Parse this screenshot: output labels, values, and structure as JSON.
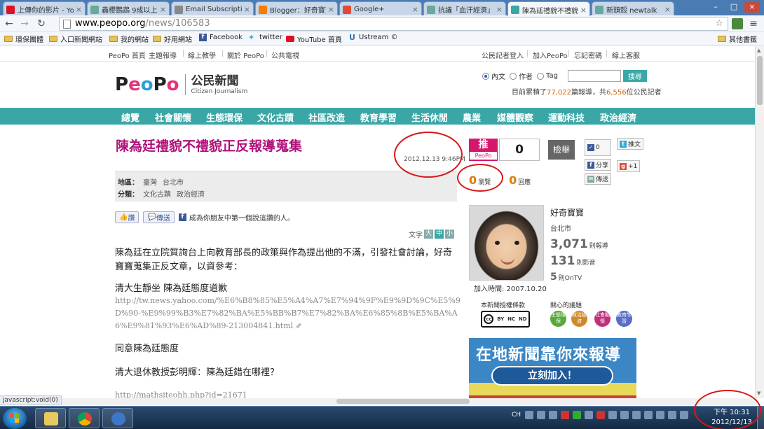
{
  "browser": {
    "tabs": [
      {
        "title": "上傳你的影片 - YouTube",
        "favcolor": "#d12"
      },
      {
        "title": "蟲櫻鸚鵡 9成以上",
        "favcolor": "#6a9"
      },
      {
        "title": "Email Subscriptions",
        "favcolor": "#888"
      },
      {
        "title": "Blogger：好奇寶寶",
        "favcolor": "#f57d00"
      },
      {
        "title": "Google+",
        "favcolor": "#dd4b39"
      },
      {
        "title": "抗議「血汗經濟」",
        "favcolor": "#6a9"
      },
      {
        "title": "陳為廷禮貌不禮貌",
        "favcolor": "#3aa6a6"
      },
      {
        "title": "新頭殼 newtalk",
        "favcolor": "#6a9"
      }
    ],
    "url_domain": "www.peopo.org",
    "url_path": "/news/106583",
    "bookmarks": [
      {
        "label": "環保團體",
        "icon": "folder-icon"
      },
      {
        "label": "入口新聞網站",
        "icon": "folder-icon"
      },
      {
        "label": "我的網站",
        "icon": "folder-icon"
      },
      {
        "label": "好用網站",
        "icon": "folder-icon"
      },
      {
        "label": "Facebook",
        "icon": "facebook-icon"
      },
      {
        "label": "twitter",
        "icon": "twitter-icon"
      },
      {
        "label": "YouTube 首頁",
        "icon": "youtube-icon"
      },
      {
        "label": "Ustream ©",
        "icon": "ustream-icon"
      }
    ],
    "other_bookmarks": "其他書籤",
    "status_text": "javascript:void(0)"
  },
  "site": {
    "top_left_links": [
      "PeoPo 首頁",
      "主題報導",
      "線上教學",
      "關於 PeoPo",
      "公共電視"
    ],
    "top_right_links": [
      "公民記者登入",
      "加入PeoPo",
      "忘記密碼",
      "線上客服"
    ],
    "logo": {
      "letters": [
        "P",
        "e",
        "o",
        "P",
        "o"
      ],
      "zh": "公民新聞",
      "en": "Citizen Journalism"
    },
    "search": {
      "options": [
        "內文",
        "作者",
        "Tag"
      ],
      "button": "搜尋",
      "placeholder": ""
    },
    "stats_prefix": "目前累積了",
    "stats_reports": "77,022",
    "stats_mid": "篇報導，共",
    "stats_reporters": "6,556",
    "stats_suffix": "位公民記者",
    "nav": [
      "總覽",
      "社會關懷",
      "生態環保",
      "文化古蹟",
      "社區改造",
      "教育學習",
      "生活休閒",
      "農業",
      "媒體觀察",
      "運動科技",
      "政治經濟"
    ]
  },
  "article": {
    "title": "陳為廷禮貌不禮貌正反報導蒐集",
    "date": "2012.12.13 9:46PM",
    "region_label": "地區：",
    "region_values": [
      "臺灣",
      "台北市"
    ],
    "category_label": "分類：",
    "category_values": [
      "文化古蹟",
      "政治經濟"
    ],
    "like_label": "讚",
    "share_label": "傳送",
    "fb_prompt": "成為你朋友中第一個說這讚的人。",
    "font_label": "文字",
    "font_sizes": [
      "大",
      "中",
      "小"
    ],
    "para1": "陳為廷在立院質詢台上向教育部長的政策與作為提出他的不滿，引發社會討論，好奇寶寶蒐集正反文章，以資參考：",
    "head1": "清大生靜坐 陳為廷態度道歉",
    "url1": "http://tw.news.yahoo.com/%E6%B8%85%E5%A4%A7%E7%94%9F%E9%9D%9C%E5%9D%90-%E9%99%B3%E7%82%BA%E5%BB%B7%E7%82%BA%E6%85%8B%E5%BA%A6%E9%81%93%E6%AD%89-213004841.html",
    "head2": "同意陳為廷態度",
    "head3": "清大退休教授彭明輝：陳為廷錯在哪裡？",
    "url2": "http://mathsiteohh.php?id=21671"
  },
  "sidebar": {
    "push_label": "推",
    "push_brand": "PeoPo",
    "push_count": "0",
    "report_button": "檢舉",
    "views": "0",
    "views_label": "瀏覽",
    "replies": "0",
    "replies_label": "回應",
    "fb_like_count": "0",
    "tweet_label": "推文",
    "fb_share_label": "分享",
    "gplus_label": "+1",
    "send_label": "傳送",
    "user_name": "好奇寶寶",
    "user_city": "台北市",
    "user_reports": "3,071",
    "user_reports_unit": "則報導",
    "user_videos": "131",
    "user_videos_unit": "則影音",
    "user_ontv": "5",
    "user_ontv_unit": "則OnTV",
    "join_date": "加入時間: 2007.10.20",
    "license_label": "本新聞授權條款",
    "cc_labels": [
      "BY",
      "NC",
      "ND"
    ],
    "topics_label": "關心的議題",
    "topics": [
      {
        "label": "生態環保",
        "color": "#59a83c"
      },
      {
        "label": "政治經濟",
        "color": "#d0882a"
      },
      {
        "label": "社會關懷",
        "color": "#c0307a"
      },
      {
        "label": "教育學習",
        "color": "#5a6ec8"
      }
    ],
    "banner_title": "在地新聞靠你來報導",
    "banner_button": "立刻加入！"
  },
  "taskbar": {
    "clock_time": "下午 10:31",
    "clock_date": "2012/12/13",
    "ime": "CH"
  }
}
